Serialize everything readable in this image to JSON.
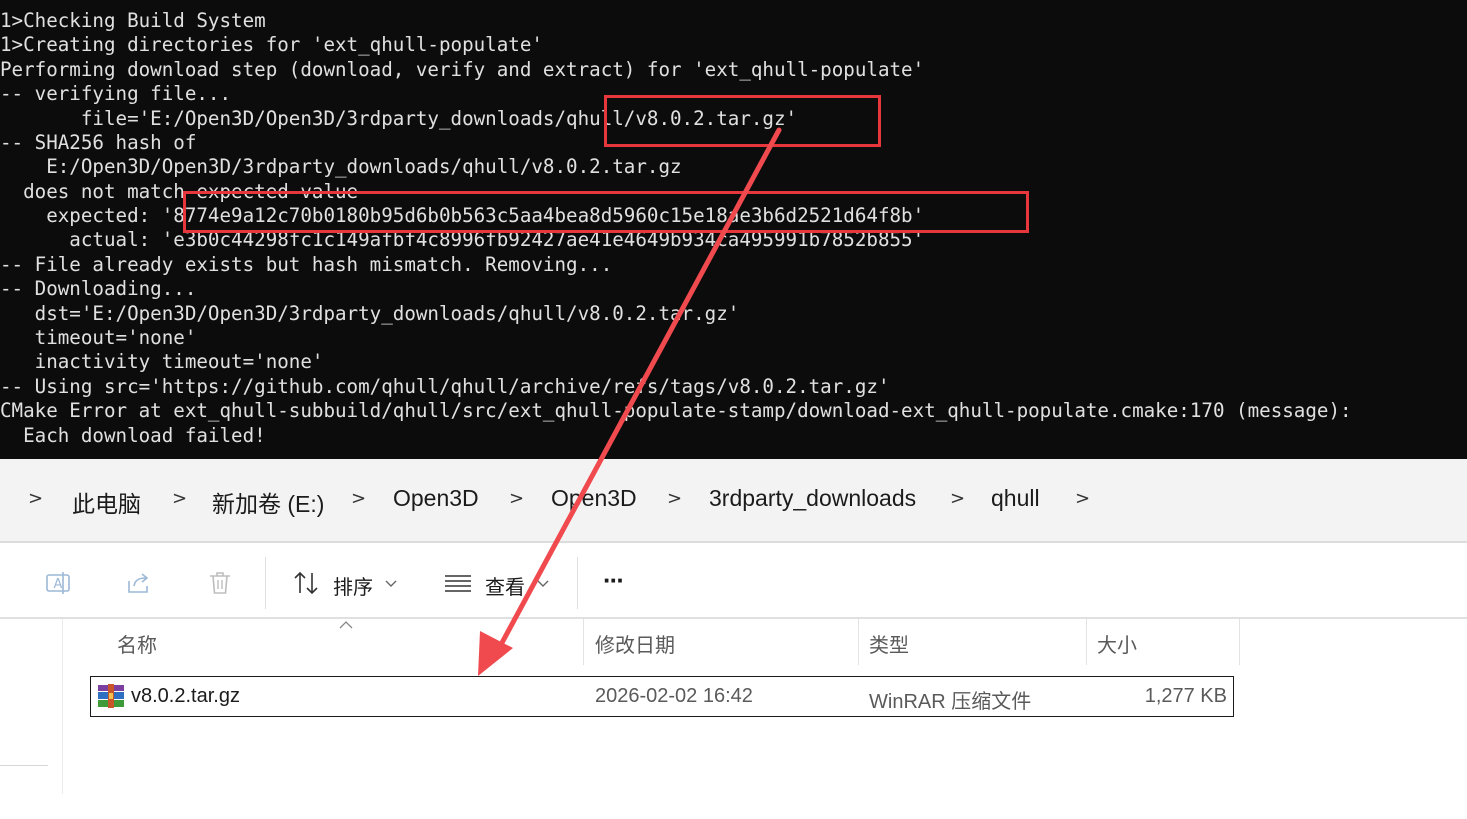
{
  "terminal": {
    "lines": [
      "1>Checking Build System",
      "1>Creating directories for 'ext_qhull-populate'",
      "Performing download step (download, verify and extract) for 'ext_qhull-populate'",
      "-- verifying file...",
      "       file='E:/Open3D/Open3D/3rdparty_downloads/qhull/v8.0.2.tar.gz'",
      "-- SHA256 hash of",
      "    E:/Open3D/Open3D/3rdparty_downloads/qhull/v8.0.2.tar.gz",
      "  does not match expected value",
      "    expected: '8774e9a12c70b0180b95d6b0b563c5aa4bea8d5960c15e18ae3b6d2521d64f8b'",
      "      actual: 'e3b0c44298fc1c149afbf4c8996fb92427ae41e4649b934ca495991b7852b855'",
      "-- File already exists but hash mismatch. Removing...",
      "-- Downloading...",
      "   dst='E:/Open3D/Open3D/3rdparty_downloads/qhull/v8.0.2.tar.gz'",
      "   timeout='none'",
      "   inactivity timeout='none'",
      "-- Using src='https://github.com/qhull/qhull/archive/refs/tags/v8.0.2.tar.gz'",
      "CMake Error at ext_qhull-subbuild/qhull/src/ext_qhull-populate-stamp/download-ext_qhull-populate.cmake:170 (message):",
      "  Each download failed!"
    ]
  },
  "breadcrumb": {
    "items": [
      "此电脑",
      "新加卷 (E:)",
      "Open3D",
      "Open3D",
      "3rdparty_downloads",
      "qhull"
    ]
  },
  "toolbar": {
    "sort_label": "排序",
    "view_label": "查看",
    "more_label": "···"
  },
  "columns": {
    "name": "名称",
    "modified": "修改日期",
    "type": "类型",
    "size": "大小"
  },
  "files": [
    {
      "name": "v8.0.2.tar.gz",
      "modified": "2026-02-02 16:42",
      "type": "WinRAR 压缩文件",
      "size": "1,277 KB"
    }
  ],
  "colors": {
    "annotation": "#e8363d",
    "terminal_bg": "#0c0c0c",
    "terminal_fg": "#e0e0e0"
  }
}
